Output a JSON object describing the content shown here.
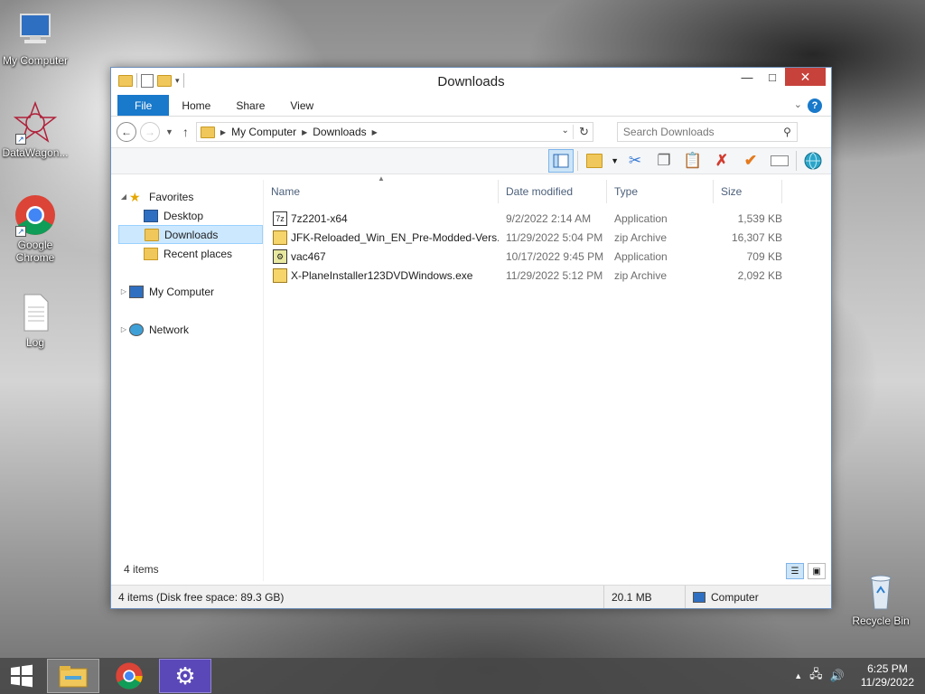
{
  "desktop": {
    "icons": [
      {
        "label": "My Computer"
      },
      {
        "label": "DataWagon..."
      },
      {
        "label": "Google Chrome"
      },
      {
        "label": "Log"
      },
      {
        "label": "Recycle Bin"
      }
    ]
  },
  "window": {
    "title": "Downloads",
    "tabs": {
      "file": "File",
      "home": "Home",
      "share": "Share",
      "view": "View"
    },
    "address": {
      "root": "My Computer",
      "current": "Downloads"
    },
    "search": {
      "placeholder": "Search Downloads"
    },
    "nav": {
      "favorites": "Favorites",
      "desktop": "Desktop",
      "downloads": "Downloads",
      "recent": "Recent places",
      "mycomputer": "My Computer",
      "network": "Network"
    },
    "columns": {
      "name": "Name",
      "date": "Date modified",
      "type": "Type",
      "size": "Size"
    },
    "files": [
      {
        "name": "7z2201-x64",
        "date": "9/2/2022 2:14 AM",
        "type": "Application",
        "size": "1,539 KB",
        "icon": "app-icon"
      },
      {
        "name": "JFK-Reloaded_Win_EN_Pre-Modded-Vers...",
        "date": "11/29/2022 5:04 PM",
        "type": "zip Archive",
        "size": "16,307 KB",
        "icon": "zip-icon"
      },
      {
        "name": "vac467",
        "date": "10/17/2022 9:45 PM",
        "type": "Application",
        "size": "709 KB",
        "icon": "app-icon"
      },
      {
        "name": "X-PlaneInstaller123DVDWindows.exe",
        "date": "11/29/2022 5:12 PM",
        "type": "zip Archive",
        "size": "2,092 KB",
        "icon": "zip-icon"
      }
    ],
    "item_count": "4 items",
    "status": {
      "left": "4 items (Disk free space: 89.3 GB)",
      "mid": "20.1 MB",
      "right": "Computer"
    }
  },
  "taskbar": {
    "time": "6:25 PM",
    "date": "11/29/2022"
  }
}
